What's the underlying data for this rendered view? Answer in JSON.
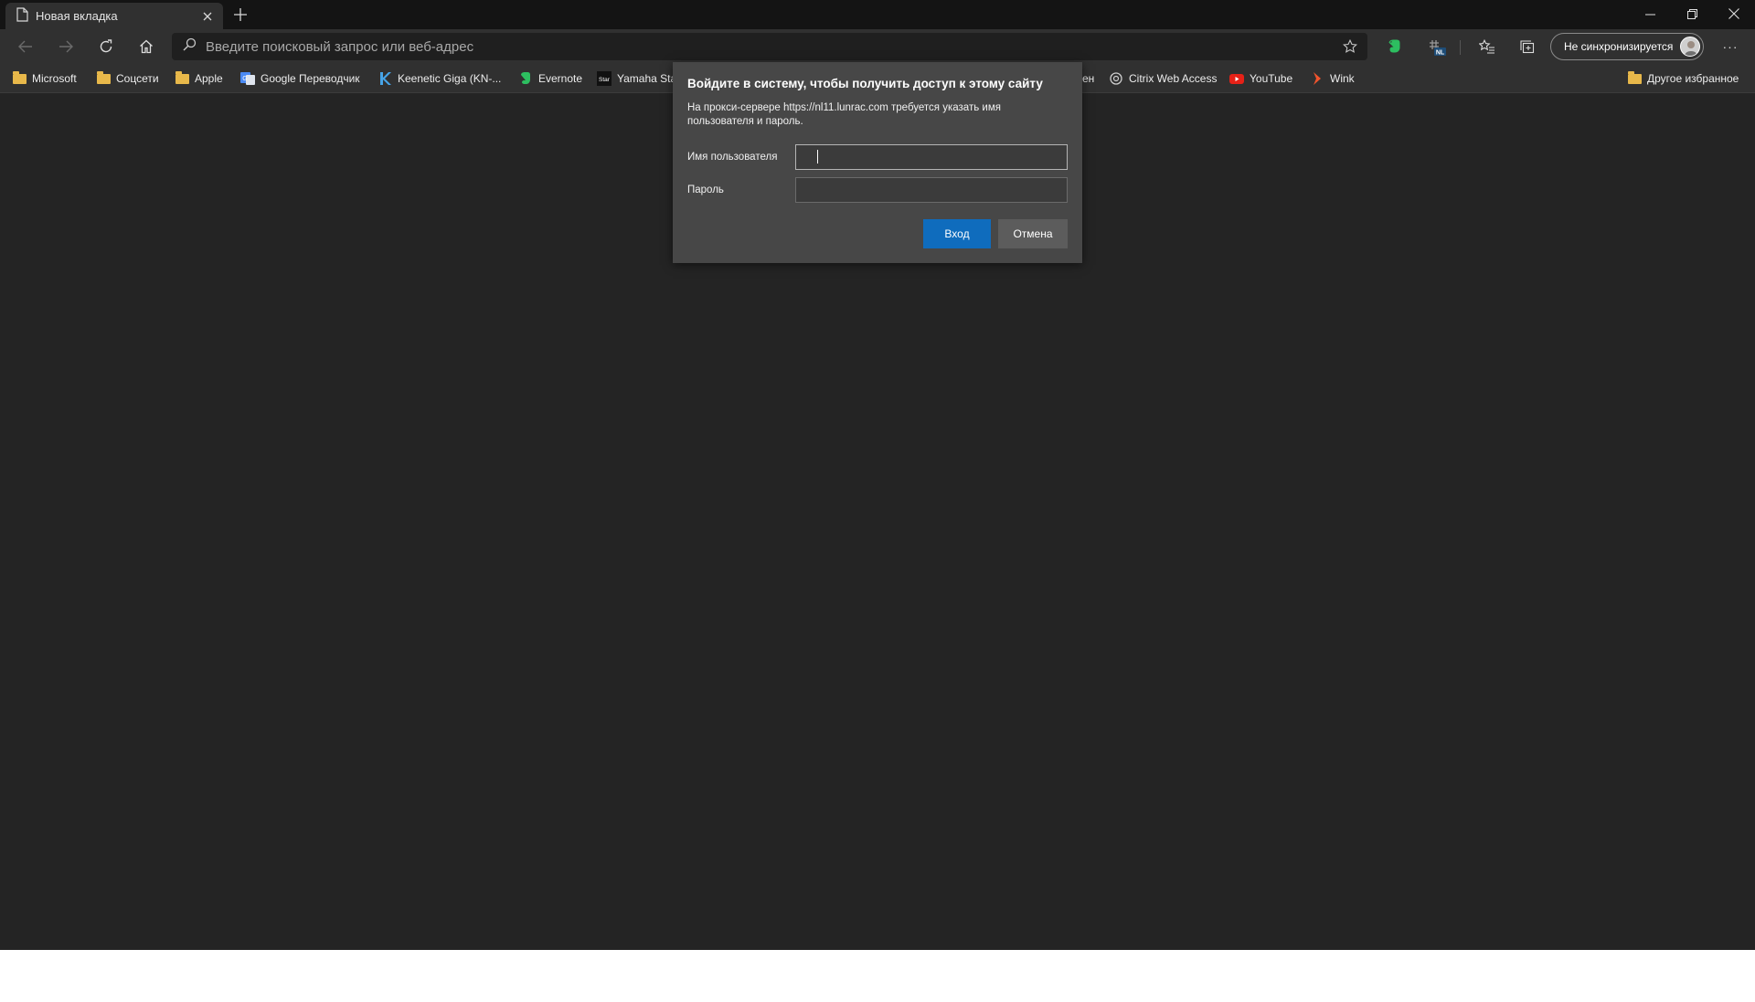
{
  "tab": {
    "title": "Новая вкладка",
    "close_label": "✕"
  },
  "new_tab_label": "+",
  "window_controls": {
    "minimize": "─",
    "restore": "❐",
    "close": "✕"
  },
  "address_bar": {
    "placeholder": "Введите поисковый запрос или веб-адрес",
    "value": ""
  },
  "profile": {
    "label": "Не синхронизируется"
  },
  "more_label": "···",
  "extension_badge": "NL",
  "bookmarks": [
    {
      "label": "Microsoft",
      "icon": "folder-icon"
    },
    {
      "label": "Соцсети",
      "icon": "folder-icon"
    },
    {
      "label": "Apple",
      "icon": "folder-icon"
    },
    {
      "label": "Google Переводчик",
      "icon": "google-translate-icon"
    },
    {
      "label": "Keenetic Giga (KN-...",
      "icon": "keenetic-icon"
    },
    {
      "label": "Evernote",
      "icon": "evernote-icon"
    },
    {
      "label": "Yamaha Sta",
      "icon": "star-badge-icon"
    },
    {
      "label": "ен",
      "icon": ""
    },
    {
      "label": "Citrix Web Access",
      "icon": "citrix-icon"
    },
    {
      "label": "YouTube",
      "icon": "youtube-icon"
    },
    {
      "label": "Wink",
      "icon": "wink-icon"
    }
  ],
  "other_favorites": {
    "label": "Другое избранное",
    "icon": "folder-icon"
  },
  "auth_dialog": {
    "title": "Войдите в систему, чтобы получить доступ к этому сайту",
    "description": "На прокси-сервере https://nl11.lunrac.com требуется указать имя пользователя и пароль.",
    "username_label": "Имя пользователя",
    "username_value": "",
    "password_label": "Пароль",
    "password_value": "",
    "login_button": "Вход",
    "cancel_button": "Отмена"
  },
  "colors": {
    "frame": "#242424",
    "toolbar": "#303030",
    "dialog": "#474747",
    "primary_button": "#0f6cbd",
    "secondary_button": "#5c5c5c"
  }
}
